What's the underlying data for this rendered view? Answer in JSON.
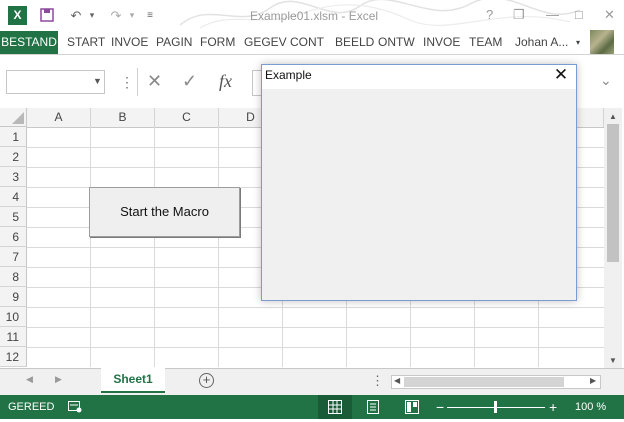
{
  "window": {
    "title": "Example01.xlsm - Excel",
    "controls": {
      "help": "?",
      "restore": "❐",
      "minimize": "—",
      "maximize": "□",
      "close": "✕"
    }
  },
  "quick_access": {
    "app_icon": "excel-logo",
    "save_icon": "save-icon",
    "undo_icon": "undo-icon",
    "redo_icon": "redo-icon"
  },
  "ribbon": {
    "tabs": [
      "BESTAND",
      "START",
      "INVOE",
      "PAGIN",
      "FORM",
      "GEGEV",
      "CONT",
      "BEELD",
      "ONTW",
      "INVOE",
      "TEAM"
    ],
    "user": "Johan A...",
    "active_color": "#217346"
  },
  "formula_bar": {
    "name_box_value": "",
    "cancel_icon": "✕",
    "enter_icon": "✓",
    "fx_label": "fx",
    "value": ""
  },
  "grid": {
    "columns": [
      "A",
      "B",
      "C",
      "D"
    ],
    "rows": [
      "1",
      "2",
      "3",
      "4",
      "5",
      "6",
      "7",
      "8",
      "9",
      "10",
      "11",
      "12"
    ]
  },
  "sheet_button": {
    "label": "Start the Macro"
  },
  "sheet_tabs": {
    "active": "Sheet1",
    "add_label": "+"
  },
  "status_bar": {
    "mode": "GEREED",
    "zoom": "100 %"
  },
  "dialog": {
    "title": "Example",
    "close_label": "✕"
  }
}
